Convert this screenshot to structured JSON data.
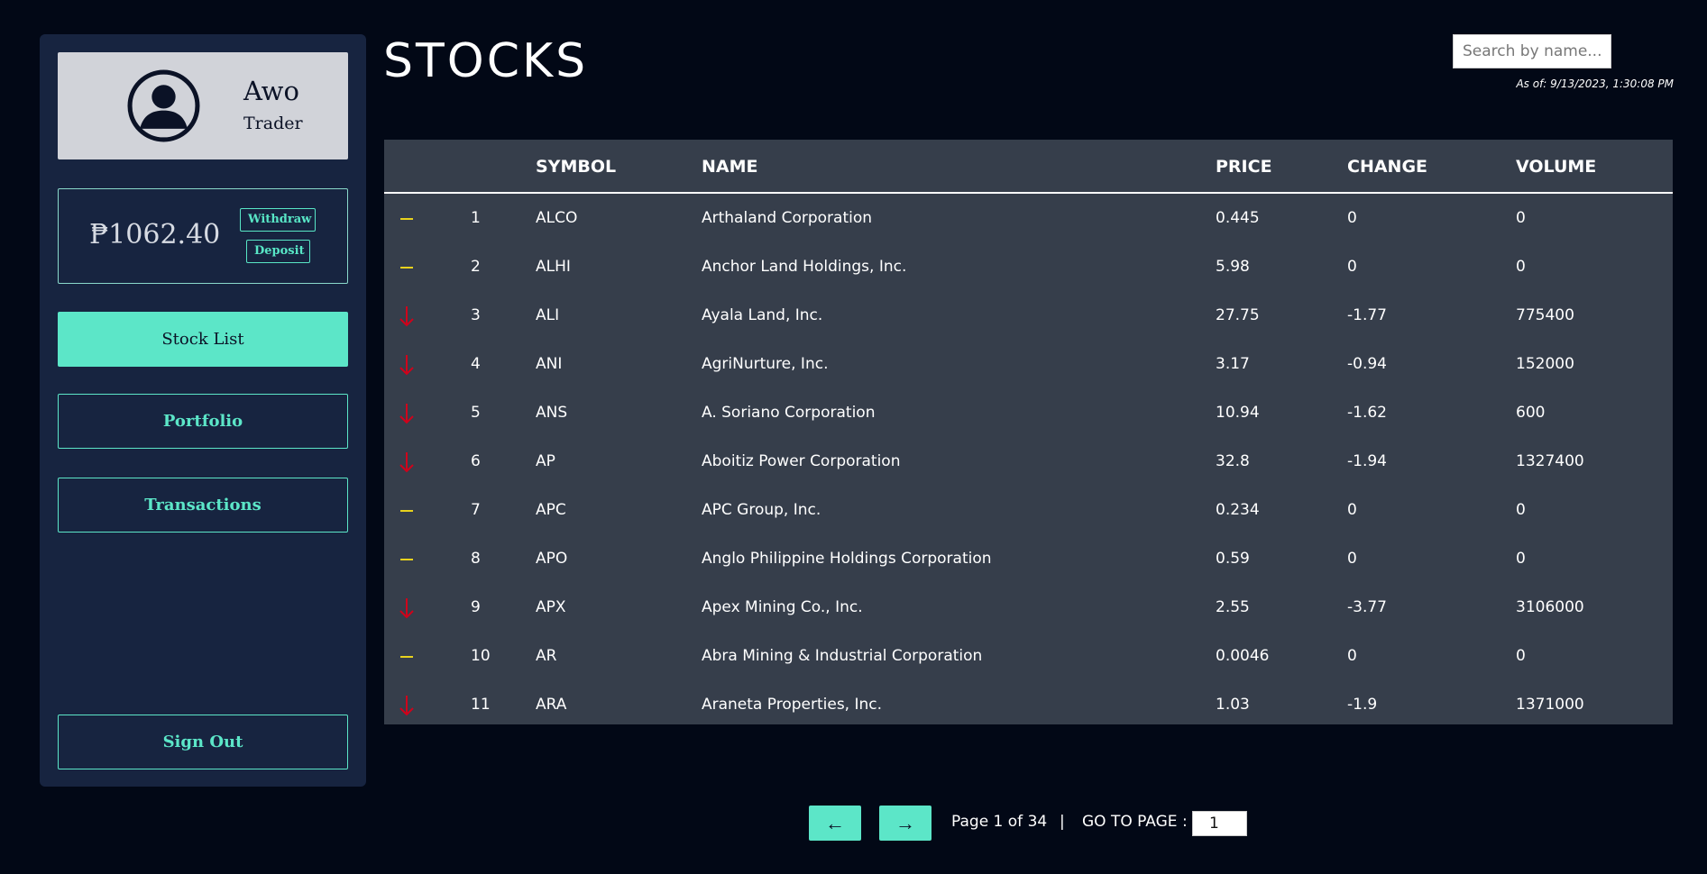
{
  "profile": {
    "name": "Awo",
    "role": "Trader"
  },
  "balance": {
    "amount": "₱1062.40",
    "withdraw_label": "Withdraw",
    "deposit_label": "Deposit"
  },
  "nav": {
    "stock_list": "Stock List",
    "portfolio": "Portfolio",
    "transactions": "Transactions",
    "sign_out": "Sign Out"
  },
  "header": {
    "title": "STOCKS",
    "search_placeholder": "Search by name...",
    "as_of": "As of: 9/13/2023, 1:30:08 PM"
  },
  "table": {
    "columns": {
      "symbol": "SYMBOL",
      "name": "NAME",
      "price": "PRICE",
      "change": "CHANGE",
      "volume": "VOLUME"
    },
    "rows": [
      {
        "trend": "flat",
        "index": "1",
        "symbol": "ALCO",
        "name": "Arthaland Corporation",
        "price": "0.445",
        "change": "0",
        "volume": "0"
      },
      {
        "trend": "flat",
        "index": "2",
        "symbol": "ALHI",
        "name": "Anchor Land Holdings, Inc.",
        "price": "5.98",
        "change": "0",
        "volume": "0"
      },
      {
        "trend": "down",
        "index": "3",
        "symbol": "ALI",
        "name": "Ayala Land, Inc.",
        "price": "27.75",
        "change": "-1.77",
        "volume": "775400"
      },
      {
        "trend": "down",
        "index": "4",
        "symbol": "ANI",
        "name": "AgriNurture, Inc.",
        "price": "3.17",
        "change": "-0.94",
        "volume": "152000"
      },
      {
        "trend": "down",
        "index": "5",
        "symbol": "ANS",
        "name": "A. Soriano Corporation",
        "price": "10.94",
        "change": "-1.62",
        "volume": "600"
      },
      {
        "trend": "down",
        "index": "6",
        "symbol": "AP",
        "name": "Aboitiz Power Corporation",
        "price": "32.8",
        "change": "-1.94",
        "volume": "1327400"
      },
      {
        "trend": "flat",
        "index": "7",
        "symbol": "APC",
        "name": "APC Group, Inc.",
        "price": "0.234",
        "change": "0",
        "volume": "0"
      },
      {
        "trend": "flat",
        "index": "8",
        "symbol": "APO",
        "name": "Anglo Philippine Holdings Corporation",
        "price": "0.59",
        "change": "0",
        "volume": "0"
      },
      {
        "trend": "down",
        "index": "9",
        "symbol": "APX",
        "name": "Apex Mining Co., Inc.",
        "price": "2.55",
        "change": "-3.77",
        "volume": "3106000"
      },
      {
        "trend": "flat",
        "index": "10",
        "symbol": "AR",
        "name": "Abra Mining & Industrial Corporation",
        "price": "0.0046",
        "change": "0",
        "volume": "0"
      },
      {
        "trend": "down",
        "index": "11",
        "symbol": "ARA",
        "name": "Araneta Properties, Inc.",
        "price": "1.03",
        "change": "-1.9",
        "volume": "1371000"
      }
    ]
  },
  "pagination": {
    "prev_label": "←",
    "next_label": "→",
    "page_info": "Page 1 of 34",
    "separator": "|",
    "goto_label": "GO TO PAGE :",
    "goto_value": "1"
  },
  "colors": {
    "accent": "#5ce6c8",
    "down": "#d0021b",
    "flat": "#e8d21d",
    "table_bg": "#363e4b",
    "sidebar_bg": "#172440"
  }
}
